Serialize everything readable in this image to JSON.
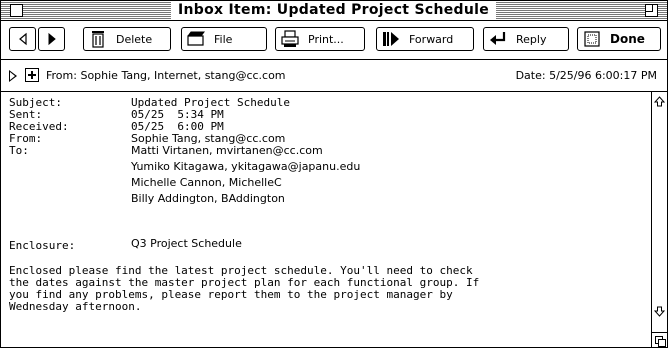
{
  "window": {
    "title": "Inbox Item: Updated Project Schedule"
  },
  "toolbar": {
    "delete_label": "Delete",
    "file_label": "File",
    "print_label": "Print...",
    "forward_label": "Forward",
    "reply_label": "Reply",
    "done_label": "Done",
    "icons": [
      "back-arrow-icon",
      "forward-arrow-icon",
      "trash-icon",
      "file-folder-icon",
      "printer-icon",
      "forward-message-icon",
      "reply-arrow-icon",
      "done-icon"
    ]
  },
  "header": {
    "from_line": "From: Sophie Tang, Internet, stang@cc.com",
    "date_line": "Date: 5/25/96 6:00:17 PM"
  },
  "message": {
    "subject_label": "Subject:",
    "subject": "Updated Project Schedule",
    "sent_label": "Sent:",
    "sent": "05/25  5:34 PM",
    "received_label": "Received:",
    "received": "05/25  6:00 PM",
    "from_label": "From:",
    "from": "Sophie Tang, stang@cc.com",
    "to_label": "To:",
    "to": [
      "Matti Virtanen, mvirtanen@cc.com",
      "Yumiko Kitagawa, ykitagawa@japanu.edu",
      "Michelle Cannon, MichelleC",
      "Billy Addington, BAddington"
    ],
    "enclosure_label": "Enclosure:",
    "enclosure": "Q3 Project Schedule",
    "body_lines": [
      "Enclosed please find the latest project schedule. You'll need to check",
      "the dates against the master project plan for each functional group. If",
      "you find any problems, please report them to the project manager by",
      "Wednesday afternoon."
    ]
  }
}
